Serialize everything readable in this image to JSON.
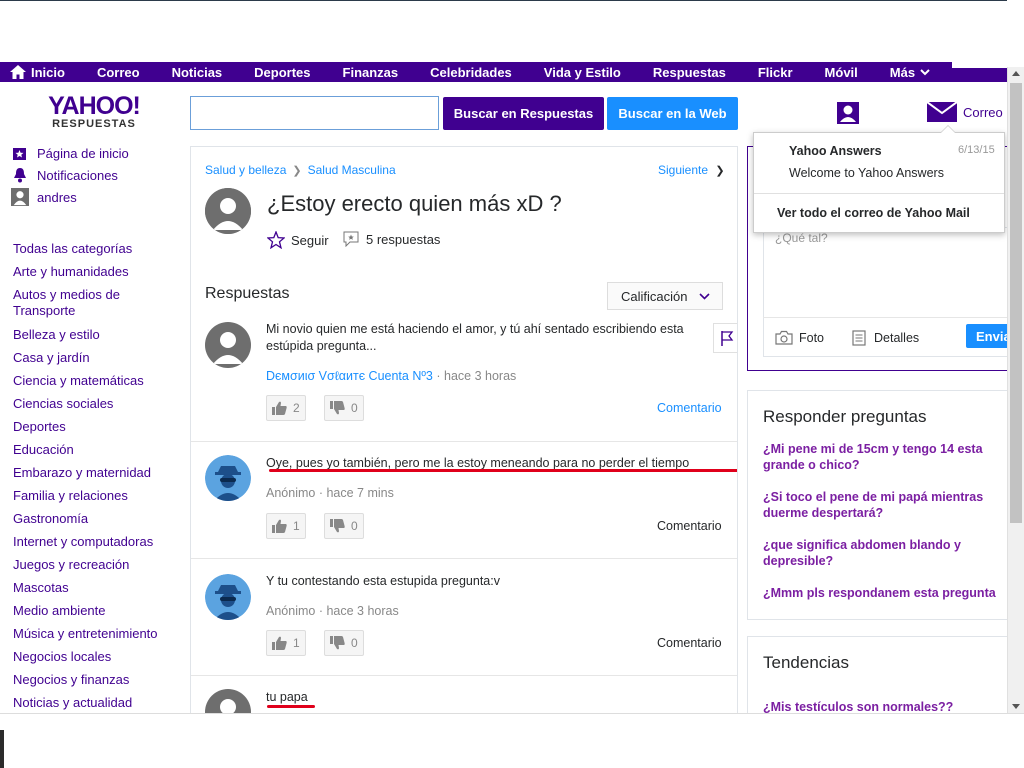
{
  "nav": {
    "items": [
      "Inicio",
      "Correo",
      "Noticias",
      "Deportes",
      "Finanzas",
      "Celebridades",
      "Vida y Estilo",
      "Respuestas",
      "Flickr",
      "Móvil",
      "Más"
    ]
  },
  "header": {
    "logo_main": "YAHOO!",
    "logo_sub": "RESPUESTAS",
    "search_value": "",
    "btn_answers": "Buscar en Respuestas",
    "btn_web": "Buscar en la Web",
    "mail_label": "Correo"
  },
  "sidebar": {
    "top": [
      "Página de inicio",
      "Notificaciones",
      "andres"
    ],
    "categories": [
      "Todas las categorías",
      "Arte y humanidades",
      "Autos y medios de",
      "Transporte",
      "Belleza y estilo",
      "Casa y jardín",
      "Ciencia y matemáticas",
      "Ciencias sociales",
      "Deportes",
      "Educación",
      "Embarazo y maternidad",
      "Familia y relaciones",
      "Gastronomía",
      "Internet y computadoras",
      "Juegos y recreación",
      "Mascotas",
      "Medio ambiente",
      "Música y entretenimiento",
      "Negocios locales",
      "Negocios y finanzas",
      "Noticias y actualidad"
    ]
  },
  "question": {
    "crumb1": "Salud y belleza",
    "crumb2": "Salud Masculina",
    "next": "Siguiente",
    "title": "¿Estoy erecto quien más xD ?",
    "follow": "Seguir",
    "answers_count": "5 respuestas",
    "respuestas_title": "Respuestas",
    "sort_label": "Calificación"
  },
  "answers": [
    {
      "text": "Mi novio quien me está haciendo el amor, y tú ahí sentado escribiendo esta estúpida pregunta...",
      "author": "Dємσиισ Vσℓαитє Cuenta Nº3",
      "time": "· hace 3 horas",
      "up": "2",
      "down": "0",
      "comment": "Comentario"
    },
    {
      "text": "Oye, pues yo también, pero me la estoy meneando para no perder el tiempo",
      "author": "Anónimo",
      "time": "· hace 7 mins",
      "up": "1",
      "down": "0",
      "comment": "Comentario"
    },
    {
      "text": "Y tu contestando esta estupida pregunta:v",
      "author": "Anónimo",
      "time": "· hace 3 horas",
      "up": "1",
      "down": "0",
      "comment": "Comentario"
    },
    {
      "text": "tu papa"
    }
  ],
  "composer": {
    "placeholder": "¿Qué tal?",
    "photo": "Foto",
    "details": "Detalles",
    "send": "Envia"
  },
  "mail_dropdown": {
    "from": "Yahoo Answers",
    "date": "6/13/15",
    "subject": "Welcome to Yahoo Answers",
    "view_all": "Ver todo el correo de Yahoo Mail"
  },
  "answer_questions": {
    "title": "Responder preguntas",
    "links": [
      "¿Mi pene mi de 15cm y tengo 14 esta grande o chico?",
      "¿Si toco el pene de mi papá mientras duerme despertará?",
      "¿que significa abdomen blando y depresible?",
      "¿Mmm pls respondanem esta pregunta"
    ]
  },
  "trends": {
    "title": "Tendencias",
    "first": "¿Mis testículos son normales??"
  },
  "colors": {
    "brand_purple": "#400090",
    "link_blue": "#198fff",
    "link_purple": "#7b1fa2",
    "underline_red": "#e0001b"
  }
}
